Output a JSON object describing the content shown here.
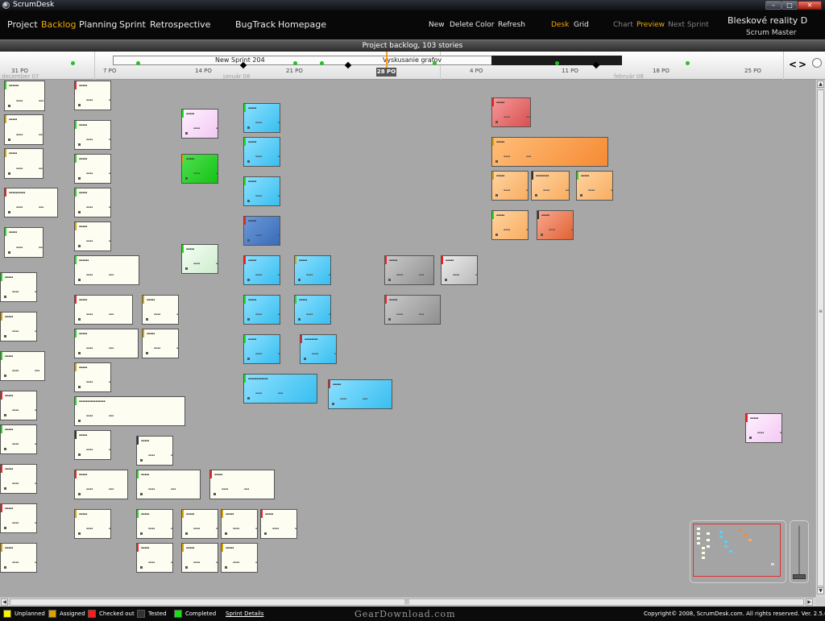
{
  "window": {
    "title": "ScrumDesk",
    "min_label": "–",
    "max_label": "□",
    "close_label": "✕"
  },
  "nav": [
    {
      "label": "Project",
      "active": false
    },
    {
      "label": "Backlog",
      "active": true
    },
    {
      "label": "Planning",
      "active": false
    },
    {
      "label": "Sprint",
      "active": false
    },
    {
      "label": "Retrospective",
      "active": false
    },
    {
      "label": "BugTrack",
      "active": false
    },
    {
      "label": "Homepage",
      "active": false
    }
  ],
  "toolbar": {
    "new": "New",
    "delete": "Delete",
    "color": "Color",
    "refresh": "Refresh"
  },
  "views": {
    "desk": "Desk",
    "grid": "Grid"
  },
  "chart_controls": {
    "chart": "Chart",
    "preview": "Preview",
    "next_sprint": "Next Sprint"
  },
  "project": {
    "name": "Bleskové reality D",
    "role": "Scrum Master"
  },
  "backlog_header": "Project backlog,  103 stories",
  "timeline": {
    "ticks": [
      "31 PO",
      "7 PO",
      "14 PO",
      "21 PO",
      "28 PO",
      "4 PO",
      "11 PO",
      "18 PO",
      "25 PO"
    ],
    "months": [
      "december 07",
      "január 08",
      "február 08"
    ],
    "today": "28 PO",
    "sprints": [
      "New Sprint 204",
      "Vyskusanie grafov"
    ],
    "prev_label": "<",
    "next_label": ">"
  },
  "colors": {
    "white": "#fdfdf2",
    "light_blue": "#5ecdf8",
    "dark_blue": "#4a7ac8",
    "orange": "#f58a34",
    "light_orange": "#f8ad60",
    "gray": "#a8a8a8",
    "green": "#16c216",
    "pink": "#f3c8f3",
    "red": "#e06060",
    "mint": "#dff5df",
    "accent": "#f2a900",
    "unplanned": "#f5f500",
    "assigned": "#d8a200",
    "checked_out": "#ff1b1b",
    "tested": "#333333",
    "completed": "#18e018"
  },
  "scrollbars": {
    "up": "▲",
    "down": "▼",
    "left": "◀",
    "right": "▶",
    "grip": "≡",
    "hgrip": "|||"
  },
  "legend": [
    {
      "label": "Unplanned",
      "color": "#f5f500"
    },
    {
      "label": "Assigned",
      "color": "#d8a200"
    },
    {
      "label": "Checked out",
      "color": "#ff1b1b"
    },
    {
      "label": "Tested",
      "color": "#333333"
    },
    {
      "label": "Completed",
      "color": "#18e018"
    }
  ],
  "sprint_details": "Sprint Details",
  "watermark": "GearDownload.com",
  "copyright": "Copyright© 2008, ScrumDesk.com. All rights reserved. Ver. 2.5.0.0"
}
